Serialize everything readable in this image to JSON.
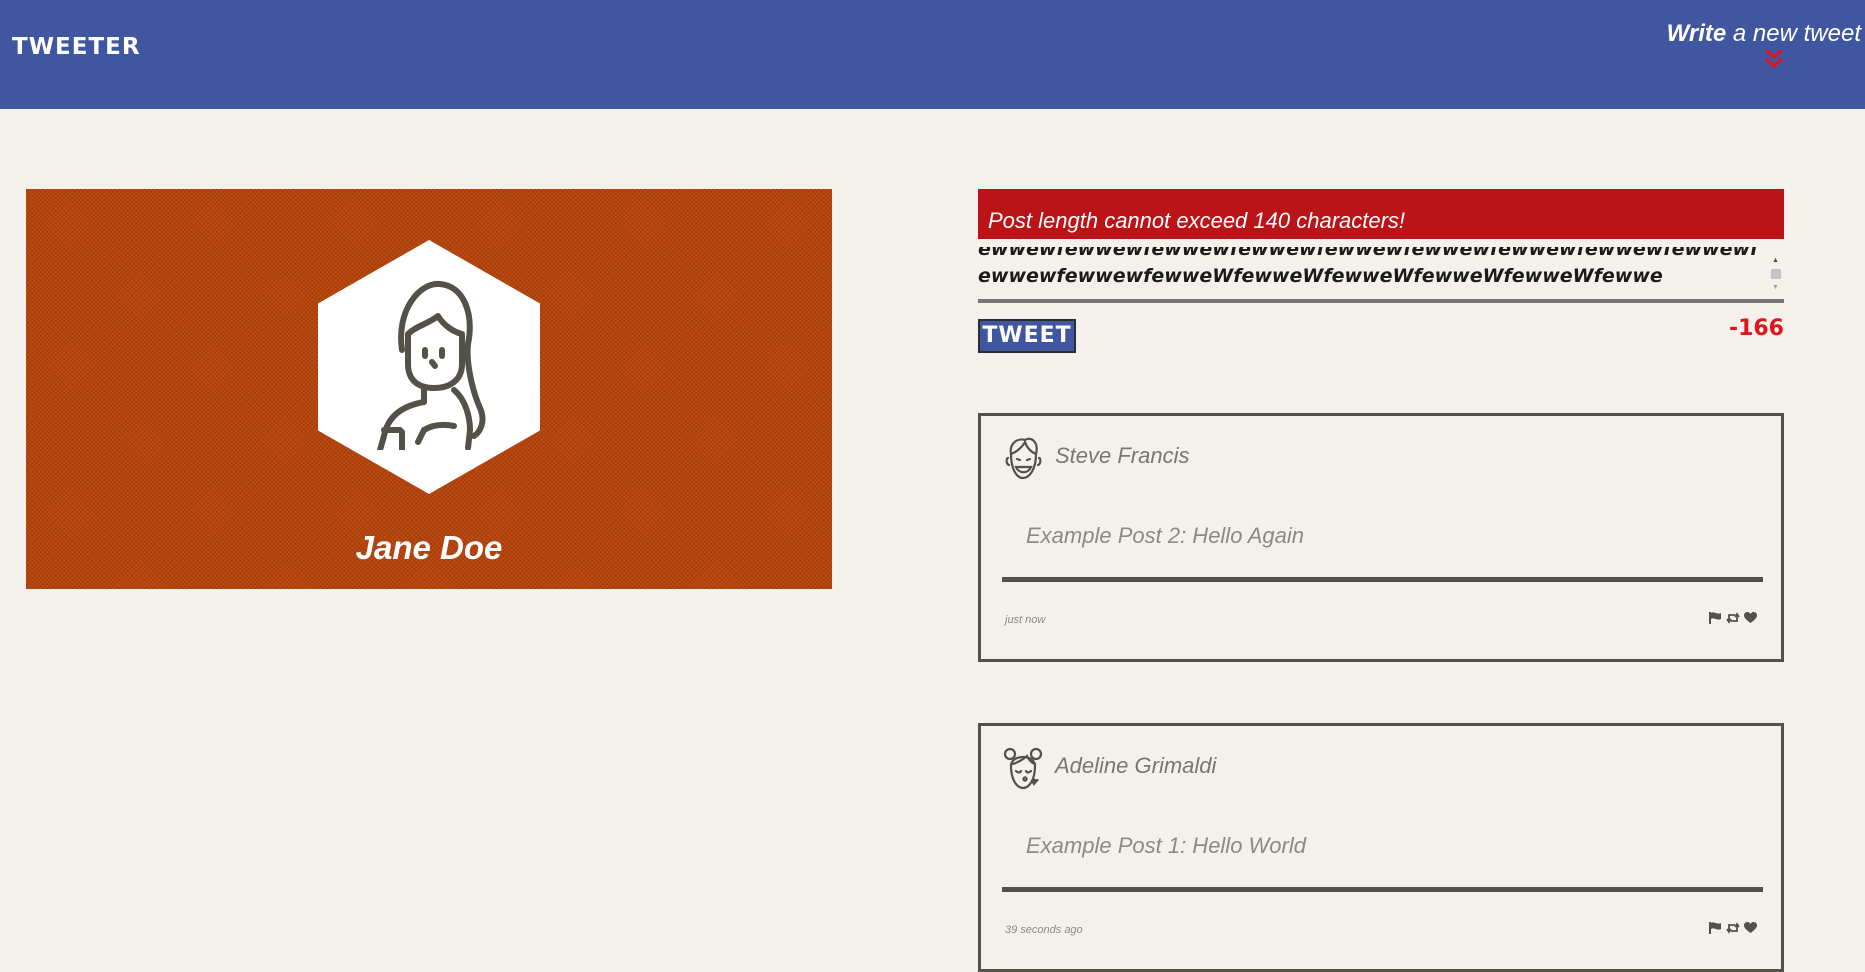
{
  "header": {
    "brand": "TWEETER",
    "compose_strong": "Write",
    "compose_rest": " a new tweet",
    "accent": "#e0141b",
    "background": "#4056a1"
  },
  "profile": {
    "name": "Jane Doe",
    "background": "#c04a12"
  },
  "composer": {
    "error": "Post length cannot exceed 140 characters!",
    "text": "ewwewfewwewfewwewfewwewfewwewfewwewfewwewfewwewfewwewfewwewfewwewfewweWfewweWfewweWfewweWfewweWfewwe",
    "button_label": "TWEET",
    "counter": "-166"
  },
  "tweets": [
    {
      "author": "Steve Francis",
      "body": "Example Post 2: Hello Again",
      "time": "just now",
      "avatar_icon": "laughing-man-avatar-icon"
    },
    {
      "author": "Adeline Grimaldi",
      "body": "Example Post 1: Hello World",
      "time": "39 seconds ago",
      "avatar_icon": "kissing-woman-avatar-icon"
    }
  ],
  "icons": [
    "flag-icon",
    "retweet-icon",
    "heart-icon",
    "double-chevron-down-icon"
  ]
}
